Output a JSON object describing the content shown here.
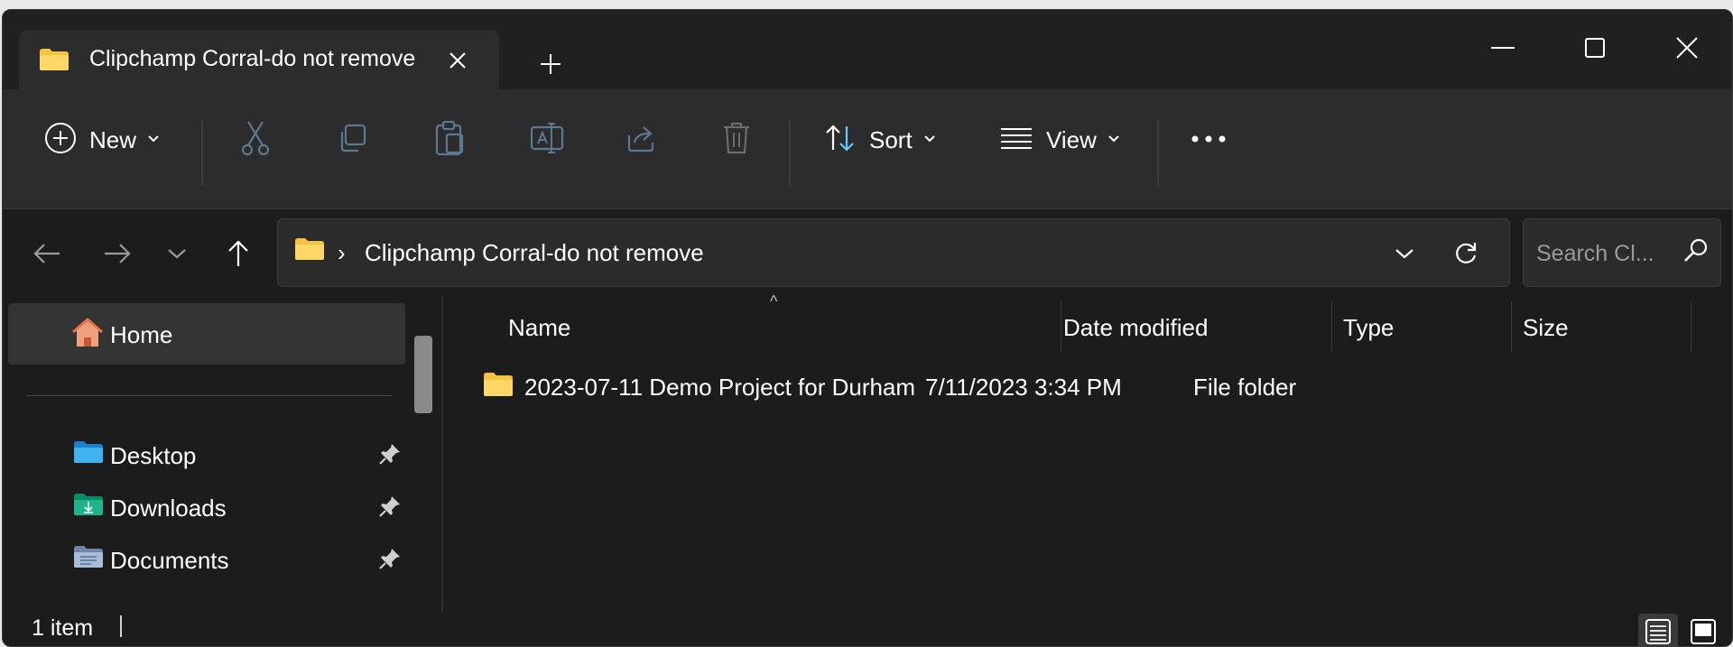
{
  "tab": {
    "title": "Clipchamp Corral-do not remove"
  },
  "toolbar": {
    "new_label": "New",
    "sort_label": "Sort",
    "view_label": "View"
  },
  "address": {
    "path": "Clipchamp Corral-do not remove",
    "separator": "›"
  },
  "search": {
    "placeholder": "Search Cl..."
  },
  "sidebar": {
    "home": "Home",
    "items": [
      {
        "label": "Desktop",
        "icon": "desktop-folder-icon"
      },
      {
        "label": "Downloads",
        "icon": "downloads-folder-icon"
      },
      {
        "label": "Documents",
        "icon": "documents-folder-icon"
      }
    ]
  },
  "columns": {
    "name": "Name",
    "date": "Date modified",
    "type": "Type",
    "size": "Size"
  },
  "files": [
    {
      "name": "2023-07-11 Demo Project for Durham",
      "date": "7/11/2023 3:34 PM",
      "type": "File folder",
      "icon": "folder-icon"
    }
  ],
  "status": {
    "count": "1 item"
  },
  "colors": {
    "folder": "#f5c242",
    "accent": "#60cdff",
    "background": "#1c1c1c",
    "toolbar": "#2c2c2c"
  }
}
